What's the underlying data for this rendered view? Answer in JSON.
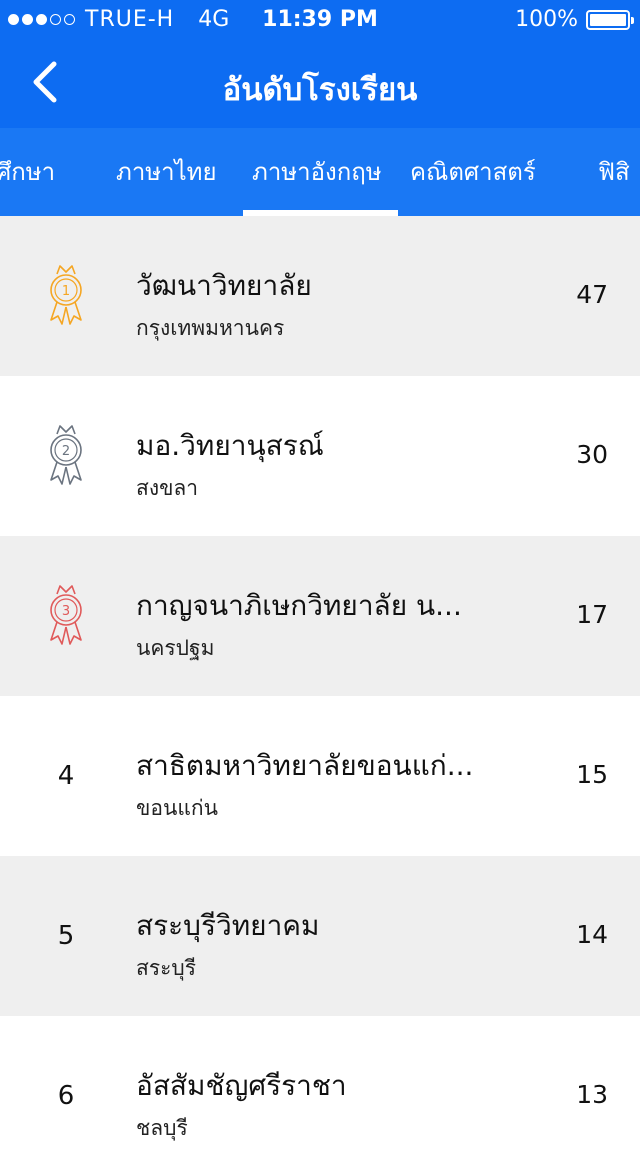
{
  "status_bar": {
    "carrier": "TRUE-H",
    "network": "4G",
    "time": "11:39 PM",
    "battery": "100%",
    "signal_strength": 3
  },
  "header": {
    "title": "อันดับโรงเรียน"
  },
  "tabs": [
    {
      "label": "ศึกษา"
    },
    {
      "label": "ภาษาไทย"
    },
    {
      "label": "ภาษาอังกฤษ",
      "active": true
    },
    {
      "label": "คณิตศาสตร์"
    },
    {
      "label": "ฟิสิ"
    }
  ],
  "rankings": [
    {
      "rank": "1",
      "name": "วัฒนาวิทยาลัย",
      "province": "กรุงเทพมหานคร",
      "score": "47",
      "medal_color": "#f5a623"
    },
    {
      "rank": "2",
      "name": "มอ.วิทยานุสรณ์",
      "province": "สงขลา",
      "score": "30",
      "medal_color": "#6b7480"
    },
    {
      "rank": "3",
      "name": "กาญจนาภิเษกวิทยาลัย น...",
      "province": "นครปฐม",
      "score": "17",
      "medal_color": "#e05a5a"
    },
    {
      "rank": "4",
      "name": "สาธิตมหาวิทยาลัยขอนแก่...",
      "province": "ขอนแก่น",
      "score": "15"
    },
    {
      "rank": "5",
      "name": "สระบุรีวิทยาคม",
      "province": "สระบุรี",
      "score": "14"
    },
    {
      "rank": "6",
      "name": "อัสสัมชัญศรีราชา",
      "province": "ชลบุรี",
      "score": "13"
    }
  ],
  "colors": {
    "header_bg": "#0d6cf2",
    "tab_bg": "#1a78f4",
    "row_shaded": "#efefef"
  }
}
